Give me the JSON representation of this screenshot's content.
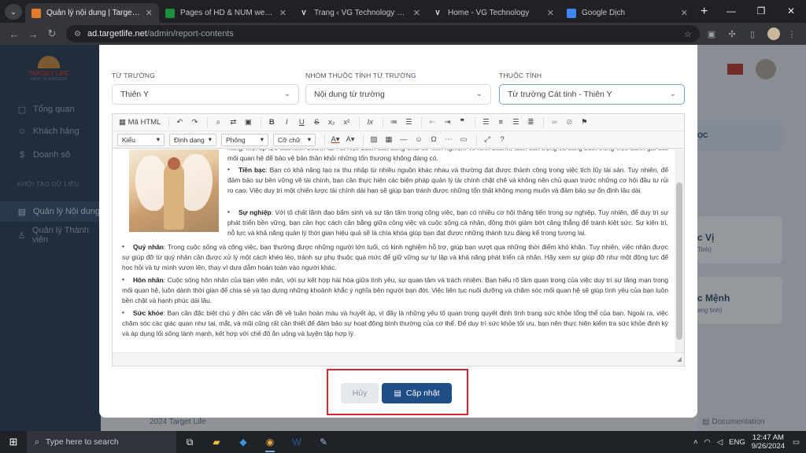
{
  "browser": {
    "tabs": [
      {
        "title": "Quản lý nội dung | Target Life",
        "fav_color": "#e07b2e",
        "active": true
      },
      {
        "title": "Pages of HD & NUM web - Goo",
        "fav_color": "#1e8e3e",
        "active": false
      },
      {
        "title": "Trang ‹ VG Technology — Wor",
        "fav_color": "#ffffff",
        "active": false
      },
      {
        "title": "Home - VG Technology",
        "fav_color": "#ffffff",
        "active": false
      },
      {
        "title": "Google Dịch",
        "fav_color": "#4285f4",
        "active": false
      }
    ],
    "url_host": "ad.targetlife.net",
    "url_path": "/admin/report-contents",
    "icons": [
      "menu-icon",
      "back-icon",
      "forward-icon",
      "reload-icon",
      "lock-icon",
      "star-icon",
      "extension-icon",
      "download-icon",
      "profile-icon",
      "kebab-icon"
    ]
  },
  "sidebar": {
    "logo_name": "TARGET LIFE",
    "logo_tagline": "PATH TO SUCCESS",
    "items": [
      {
        "label": "Tổng quan",
        "icon": "dashboard-icon"
      },
      {
        "label": "Khách hàng",
        "icon": "users-icon"
      },
      {
        "label": "Doanh số",
        "icon": "dollar-icon"
      }
    ],
    "section_title": "KHỞI TẠO DỮ LIỆU",
    "items2": [
      {
        "label": "Quản lý Nội dung",
        "icon": "clipboard-icon",
        "active": true
      },
      {
        "label": "Quản lý Thành viên",
        "icon": "user-icon",
        "active": false
      }
    ]
  },
  "background": {
    "header_fragment": "ỌC",
    "card1_title": "c Vị",
    "card1_sub": "Tinh)",
    "card2_title": "c Mệnh",
    "card2_sub": "ang tinh)",
    "footer_left": "2024 Target Life",
    "footer_right": "Documentation"
  },
  "form": {
    "field1_label": "TỪ TRƯỜNG",
    "field1_value": "Thiên Y",
    "field2_label": "NHÓM THUỘC TÍNH TỪ TRƯỜNG",
    "field2_value": "Nội dung từ trường",
    "field3_label": "THUỘC TÍNH",
    "field3_value": "Từ trường Cát tinh - Thiên Y"
  },
  "editor": {
    "toolbar": {
      "source_label": "Mã HTML",
      "style_label": "Kiểu",
      "format_label": "Định dạng",
      "font_label": "Phông",
      "size_label": "Cỡ chữ"
    },
    "content": {
      "p0": "năng, mọi áp lực của kinh doanh tại Hà Nội. Luôn sẵn sàng chia sẻ kinh nghiệm về kinh doanh, luôn cần trọng và sáng suốt trong việc đánh giá các mối quan hệ để bảo vệ bản thân khỏi những tổn thương không đáng có.",
      "p1_title": "Tiền bạc",
      "p1": ": Bạn có khả năng tạo ra thu nhập từ nhiều nguồn khác nhau và thường đạt được thành công trong việc tích lũy tài sản. Tuy nhiên, để đảm bảo sự bền vững về tài chính, bạn cần thực hiện các biện pháp quản lý tài chính chặt chẽ và không nên chủ quan trước những cơ hội đầu tư rủi ro cao. Việc duy trì một chiến lược tài chính dài hạn sẽ giúp bạn tránh được những tổn thất không mong muốn và đảm bảo sự ổn định lâu dài.",
      "p2_title": "Sự nghiệp",
      "p2": ": Với tố chất lãnh đạo bẩm sinh và sự tận tâm trong công việc, bạn có nhiều cơ hội thăng tiến trong sự nghiệp. Tuy nhiên, để duy trì sự phát triển bền vững, bạn cần học cách cân bằng giữa công việc và cuộc sống cá nhân, đồng thời giảm bớt căng thẳng để tránh kiệt sức. Sự kiên trì, nỗ lực và khả năng quản lý thời gian hiệu quả sẽ là chìa khóa giúp bạn đạt được những thành tựu đáng kể trong tương lai.",
      "p3_title": "Quý nhân",
      "p3": ": Trong cuộc sống và công việc, bạn thường được những người lớn tuổi, có kinh nghiệm hỗ trợ, giúp bạn vượt qua những thời điểm khó khăn. Tuy nhiên, việc nhận được sự giúp đỡ từ quý nhân cần được xử lý một cách khéo léo, tránh sự phụ thuộc quá mức để giữ vững sự tự lập và khả năng phát triển cá nhân. Hãy xem sự giúp đỡ như một động lực để học hỏi và tự mình vươn lên, thay vì dựa dẫm hoàn toàn vào người khác.",
      "p4_title": "Hôn nhân",
      "p4": ": Cuộc sống hôn nhân của bạn viên mãn, với sự kết hợp hài hòa giữa tình yêu, sự quan tâm và trách nhiệm. Bạn hiểu rõ tầm quan trọng của việc duy trì sự lãng mạn trong mối quan hệ, luôn dành thời gian để chia sẻ và tạo dựng những khoảnh khắc ý nghĩa bên người bạn đời. Việc liên tục nuôi dưỡng và chăm sóc mối quan hệ sẽ giúp tình yêu của bạn luôn bền chặt và hạnh phúc dài lâu.",
      "p5_title": "Sức khỏe",
      "p5": ": Bạn cần đặc biệt chú ý đến các vấn đề về tuần hoàn máu và huyết áp, vì đây là những yếu tố quan trọng quyết định tình trạng sức khỏe tổng thể của bạn. Ngoài ra, việc chăm sóc các giác quan như tai, mắt, và mũi cũng rất cần thiết để đảm bảo sự hoạt động bình thường của cơ thể. Để duy trì sức khỏe tối ưu, bạn nên thực hiện kiểm tra sức khỏe định kỳ và áp dụng lối sống lành mạnh, kết hợp với chế độ ăn uống và luyện tập hợp lý."
    }
  },
  "actions": {
    "cancel_label": "Hủy",
    "update_label": "Cập nhật",
    "update_color": "#1f4e87",
    "highlight_color": "#d9232e"
  },
  "taskbar": {
    "search_placeholder": "Type here to search",
    "lang": "ENG",
    "time": "12:47 AM",
    "date": "9/26/2024"
  }
}
